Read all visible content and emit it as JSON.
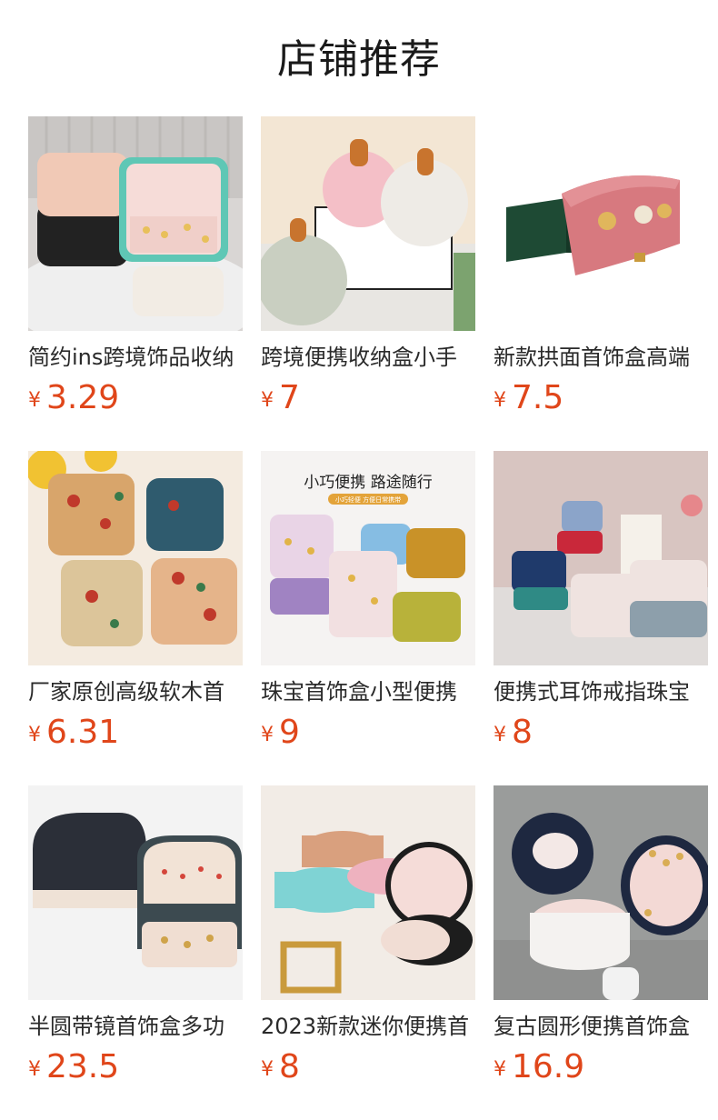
{
  "header": {
    "title": "店铺推荐"
  },
  "currency_symbol": "¥",
  "products": [
    {
      "name": "简约ins跨境饰品收纳",
      "price": "3.29",
      "thumb_icon": "jewelry-box-image"
    },
    {
      "name": "跨境便携收纳盒小手",
      "price": "7",
      "thumb_icon": "round-case-image"
    },
    {
      "name": "新款拱面首饰盒高端",
      "price": "7.5",
      "thumb_icon": "ring-case-image"
    },
    {
      "name": "厂家原创高级软木首",
      "price": "6.31",
      "thumb_icon": "cork-box-image"
    },
    {
      "name": "珠宝首饰盒小型便携",
      "price": "9",
      "thumb_icon": "colorful-box-image",
      "banner": "小巧便携 路途随行",
      "sub_banner": "小巧轻便 方便日常携带"
    },
    {
      "name": "便携式耳饰戒指珠宝",
      "price": "8",
      "thumb_icon": "velvet-box-image"
    },
    {
      "name": "半圆带镜首饰盒多功",
      "price": "23.5",
      "thumb_icon": "semicircle-box-image"
    },
    {
      "name": "2023新款迷你便携首",
      "price": "8",
      "thumb_icon": "mini-round-box-image"
    },
    {
      "name": "复古圆形便携首饰盒",
      "price": "16.9",
      "thumb_icon": "vintage-round-box-image"
    }
  ]
}
